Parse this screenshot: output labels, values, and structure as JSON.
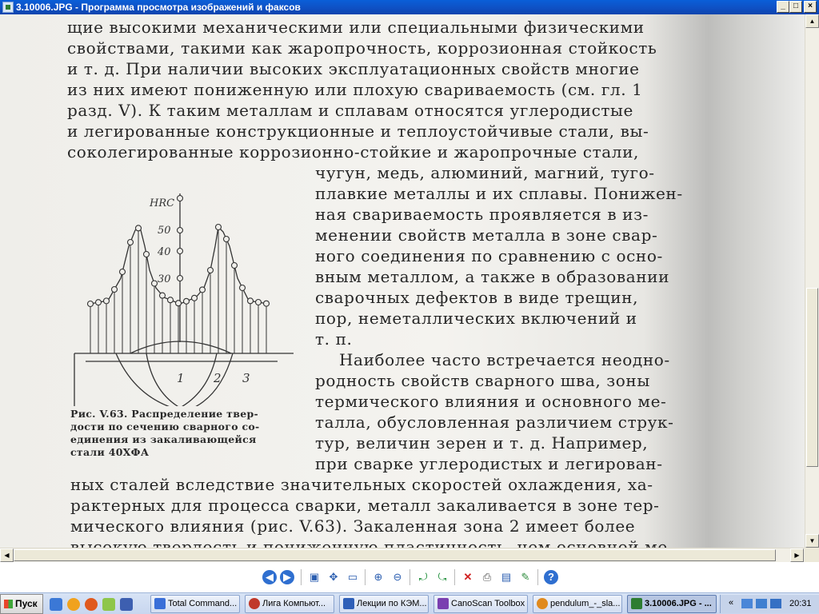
{
  "window": {
    "title": "3.10006.JPG - Программа просмотра изображений и факсов",
    "min_icon": "minimize-icon",
    "max_icon": "maximize-icon",
    "close_icon": "close-icon"
  },
  "document": {
    "top_lines": [
      "щие высокими механическими или специальными физическими",
      "свойствами, такими как жаропрочность, коррозионная стойкость",
      "и т. д. При наличии высоких эксплуатационных свойств многие",
      "из них имеют пониженную или плохую свариваемость (см. гл. 1",
      "разд. V). К таким металлам и сплавам относятся углеродистые",
      "и легированные конструкционные и теплоустойчивые стали, вы-",
      "соколегированные коррозионно-стойкие и жаропрочные стали,"
    ],
    "right_lines": [
      "чугун, медь, алюминий, магний, туго-",
      "плавкие металлы и их сплавы. Понижен-",
      "ная свариваемость проявляется в из-",
      "менении свойств металла в зоне свар-",
      "ного соединения по сравнению с осно-",
      "вным металлом, а также в образовании",
      "сварочных дефектов в виде трещин,",
      "пор, неметаллических включений и",
      "т. п.",
      "Наиболее часто встречается неодно-",
      "родность свойств сварного шва, зоны",
      "термического влияния и основного ме-",
      "талла, обусловленная различием струк-",
      "тур, величин зерен и т. д. Например,",
      "при сварке углеродистых и легирован-"
    ],
    "bottom_lines": [
      "ных сталей вследствие значительных скоростей охлаждения, ха-",
      "рактерных для процесса сварки, металл закаливается в зоне тер-",
      "мического влияния (рис. V.63). Закаленная зона 2 имеет более",
      "высокую твердость и пониженную пластичность, чем основной ме-"
    ],
    "caption_lines": [
      "Рис. V.63. Распределение твер-",
      "дости по сечению сварного со-",
      "единения из закаливающейся",
      "стали 40ХФА"
    ],
    "figure": {
      "axis_label": "HRC",
      "ticks": [
        "50",
        "40",
        "30"
      ],
      "zones": [
        "1",
        "2",
        "3"
      ]
    }
  },
  "toolbar": {
    "buttons": [
      "prev-image-icon",
      "next-image-icon",
      "best-fit-icon",
      "actual-size-icon",
      "slideshow-icon",
      "zoom-in-icon",
      "zoom-out-icon",
      "rotate-cw-icon",
      "rotate-ccw-icon",
      "delete-icon",
      "print-icon",
      "save-icon",
      "edit-icon",
      "help-icon"
    ]
  },
  "taskbar": {
    "start_label": "Пуск",
    "tasks": [
      {
        "label": "Total Command...",
        "icon_color": "#3a6fd8"
      },
      {
        "label": "Лига Компьют...",
        "icon_color": "#c0392b"
      },
      {
        "label": "Лекции по КЭМ...",
        "icon_color": "#2e5fb8"
      },
      {
        "label": "CanoScan Toolbox",
        "icon_color": "#7a3fb0"
      },
      {
        "label": "pendulum_-_sla...",
        "icon_color": "#e08a1e"
      },
      {
        "label": "3.10006.JPG - ...",
        "icon_color": "#2e7d32"
      }
    ],
    "tray_chevron": "«",
    "clock": "20:31"
  }
}
